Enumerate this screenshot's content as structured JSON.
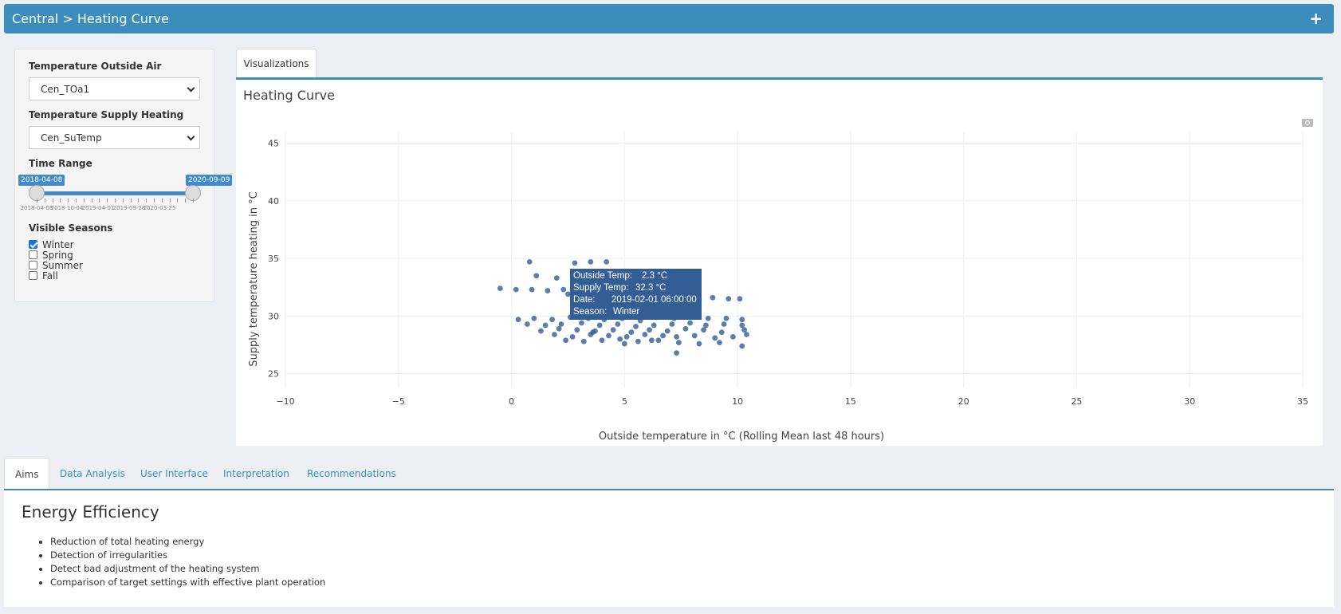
{
  "header": {
    "title": "Central > Heating Curve",
    "expand_icon": "plus-icon"
  },
  "sidebar": {
    "outside_air": {
      "label": "Temperature Outside Air",
      "value": "Cen_TOa1"
    },
    "supply_heating": {
      "label": "Temperature Supply Heating",
      "value": "Cen_SuTemp"
    },
    "time_range": {
      "label": "Time Range",
      "from": "2018-04-08",
      "to": "2020-09-09",
      "ticks": [
        "2018-04-08",
        "2018-10-04",
        "2019-04-01",
        "2019-09-28",
        "2020-03-25"
      ]
    },
    "seasons": {
      "label": "Visible Seasons",
      "items": [
        {
          "label": "Winter",
          "checked": true
        },
        {
          "label": "Spring",
          "checked": false
        },
        {
          "label": "Summer",
          "checked": false
        },
        {
          "label": "Fall",
          "checked": false
        }
      ]
    }
  },
  "top_tab": "Visualizations",
  "panel": {
    "title": "Heating Curve",
    "camera_icon": "camera-icon"
  },
  "chart_data": {
    "type": "scatter",
    "xlabel": "Outside temperature in °C (Rolling Mean last 48 hours)",
    "ylabel": "Supply temperature heating in °C",
    "xlim": [
      -10,
      35
    ],
    "ylim": [
      23.8,
      46
    ],
    "xticks": [
      -10,
      -5,
      0,
      5,
      10,
      15,
      20,
      25,
      30,
      35
    ],
    "yticks": [
      25,
      30,
      35,
      40,
      45
    ],
    "xtick_labels": [
      "−10",
      "−5",
      "0",
      "5",
      "10",
      "15",
      "20",
      "25",
      "30",
      "35"
    ],
    "yticks_labels": [
      "25",
      "30",
      "35",
      "40",
      "45"
    ],
    "grid": true,
    "color": "#335e95",
    "series": [
      {
        "x": [
          -0.5,
          0.2,
          0.9,
          1.6,
          2.3,
          0.8,
          1.1,
          2.0,
          2.8,
          3.5,
          4.2,
          2.5,
          3.0,
          3.8,
          4.6,
          5.4,
          6.0,
          6.8,
          7.5,
          8.2,
          8.9,
          9.6,
          10.1,
          0.3,
          1.0,
          1.8,
          2.6,
          3.4,
          4.1,
          4.9,
          5.7,
          6.4,
          7.2,
          8.0,
          8.7,
          9.5,
          10.2,
          0.7,
          1.5,
          2.2,
          3.1,
          3.9,
          4.7,
          5.5,
          6.3,
          7.1,
          7.9,
          8.6,
          9.4,
          10.2,
          1.3,
          2.1,
          2.9,
          3.7,
          4.5,
          5.3,
          6.1,
          6.9,
          7.7,
          8.5,
          9.3,
          10.3,
          1.9,
          2.7,
          3.5,
          4.3,
          5.1,
          5.9,
          6.7,
          7.3,
          8.1,
          9.0,
          9.8,
          10.4,
          2.4,
          3.2,
          4.0,
          4.8,
          5.6,
          6.5,
          7.4,
          8.3,
          9.2,
          10.2,
          3.6,
          5.0,
          6.2,
          7.3
        ],
        "y": [
          32.4,
          32.3,
          32.3,
          32.2,
          32.3,
          34.7,
          33.5,
          33.3,
          34.6,
          34.7,
          34.7,
          31.9,
          32.2,
          31.5,
          31.3,
          31.1,
          31.5,
          31.3,
          31.6,
          31.7,
          31.6,
          31.5,
          31.5,
          29.7,
          29.8,
          29.7,
          29.9,
          29.8,
          29.7,
          29.8,
          29.6,
          29.9,
          29.8,
          29.9,
          29.8,
          29.8,
          29.7,
          29.3,
          29.2,
          29.3,
          29.4,
          29.2,
          29.3,
          29.1,
          29.2,
          29.3,
          29.4,
          29.2,
          29.3,
          29.2,
          28.7,
          28.9,
          28.8,
          28.7,
          28.8,
          28.6,
          28.8,
          28.7,
          28.9,
          28.8,
          28.6,
          28.8,
          28.4,
          28.2,
          28.4,
          28.3,
          28.2,
          28.4,
          28.3,
          28.2,
          28.3,
          28.1,
          28.2,
          28.4,
          27.9,
          27.8,
          27.9,
          28.0,
          27.8,
          27.9,
          27.7,
          27.6,
          27.7,
          27.4,
          28.6,
          27.6,
          27.9,
          26.8
        ]
      }
    ],
    "tooltip": {
      "rows": [
        {
          "key": "Outside Temp:",
          "value": "2.3 °C"
        },
        {
          "key": "Supply Temp:",
          "value": "32.3 °C"
        },
        {
          "key": "Date:",
          "value": "2019-02-01 06:00:00"
        },
        {
          "key": "Season:",
          "value": "Winter"
        }
      ]
    }
  },
  "bottom_tabs": [
    "Aims",
    "Data Analysis",
    "User Interface",
    "Interpretation",
    "Recommendations"
  ],
  "aims": {
    "heading": "Energy Efficiency",
    "bullets": [
      "Reduction of total heating energy",
      "Detection of irregularities",
      "Detect bad adjustment of the heating system",
      "Comparison of target settings with effective plant operation"
    ]
  }
}
